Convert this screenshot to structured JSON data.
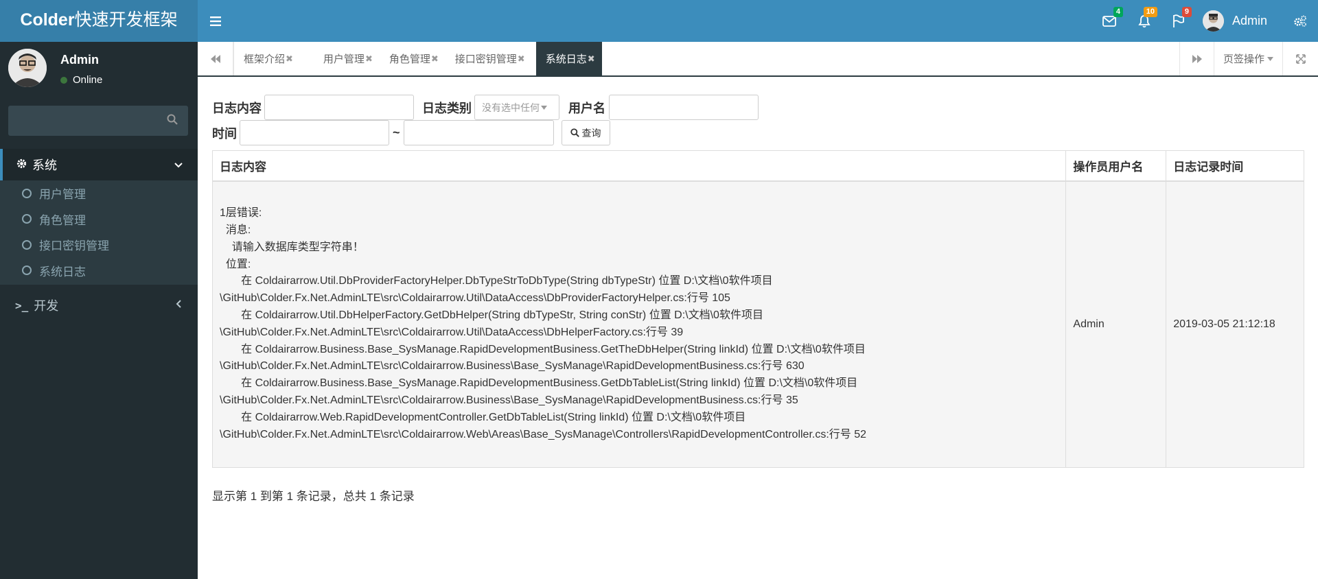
{
  "app": {
    "logo_bold": "Colder",
    "logo_rest": "快速开发框架"
  },
  "header": {
    "mail_count": "4",
    "bell_count": "10",
    "flag_count": "9",
    "username": "Admin"
  },
  "sidebar": {
    "user_name": "Admin",
    "user_status": "Online",
    "search_placeholder": "",
    "menu_system": "系统",
    "sub_items": [
      "用户管理",
      "角色管理",
      "接口密钥管理",
      "系统日志"
    ],
    "menu_dev": "开发"
  },
  "tabs": {
    "items": [
      "框架介绍",
      "用户管理",
      "角色管理",
      "接口密钥管理",
      "系统日志"
    ],
    "active": "系统日志",
    "page_ops": "页签操作"
  },
  "filters": {
    "log_content_label": "日志内容",
    "log_type_label": "日志类别",
    "log_type_placeholder": "没有选中任何",
    "username_label": "用户名",
    "time_label": "时间",
    "tilde": "~",
    "query_button": "查询"
  },
  "table": {
    "headers": [
      "日志内容",
      "操作员用户名",
      "日志记录时间"
    ],
    "rows": [
      {
        "content": "1层错误:\n  消息:\n    请输入数据库类型字符串！\n  位置:\n       在 Coldairarrow.Util.DbProviderFactoryHelper.DbTypeStrToDbType(String dbTypeStr) 位置 D:\\文档\\0软件项目\n\\GitHub\\Colder.Fx.Net.AdminLTE\\src\\Coldairarrow.Util\\DataAccess\\DbProviderFactoryHelper.cs:行号 105\n       在 Coldairarrow.Util.DbHelperFactory.GetDbHelper(String dbTypeStr, String conStr) 位置 D:\\文档\\0软件项目\n\\GitHub\\Colder.Fx.Net.AdminLTE\\src\\Coldairarrow.Util\\DataAccess\\DbHelperFactory.cs:行号 39\n       在 Coldairarrow.Business.Base_SysManage.RapidDevelopmentBusiness.GetTheDbHelper(String linkId) 位置 D:\\文档\\0软件项目\n\\GitHub\\Colder.Fx.Net.AdminLTE\\src\\Coldairarrow.Business\\Base_SysManage\\RapidDevelopmentBusiness.cs:行号 630\n       在 Coldairarrow.Business.Base_SysManage.RapidDevelopmentBusiness.GetDbTableList(String linkId) 位置 D:\\文档\\0软件项目\n\\GitHub\\Colder.Fx.Net.AdminLTE\\src\\Coldairarrow.Business\\Base_SysManage\\RapidDevelopmentBusiness.cs:行号 35\n       在 Coldairarrow.Web.RapidDevelopmentController.GetDbTableList(String linkId) 位置 D:\\文档\\0软件项目\n\\GitHub\\Colder.Fx.Net.AdminLTE\\src\\Coldairarrow.Web\\Areas\\Base_SysManage\\Controllers\\RapidDevelopmentController.cs:行号 52",
        "user": "Admin",
        "time": "2019-03-05 21:12:18"
      }
    ]
  },
  "pagination": {
    "info": "显示第 1 到第 1 条记录，总共 1 条记录"
  },
  "colors": {
    "header": "#3c8dbc",
    "logo_bg": "#367fa9",
    "sidebar": "#222d32",
    "active_tab": "#2c3b41"
  },
  "icons": {
    "menu_toggle": "bars-icon",
    "mail": "envelope-icon",
    "bell": "bell-icon",
    "flag": "flag-icon",
    "settings": "gears-icon",
    "search": "search-icon",
    "system": "gear-icon",
    "dev": "terminal-icon"
  }
}
